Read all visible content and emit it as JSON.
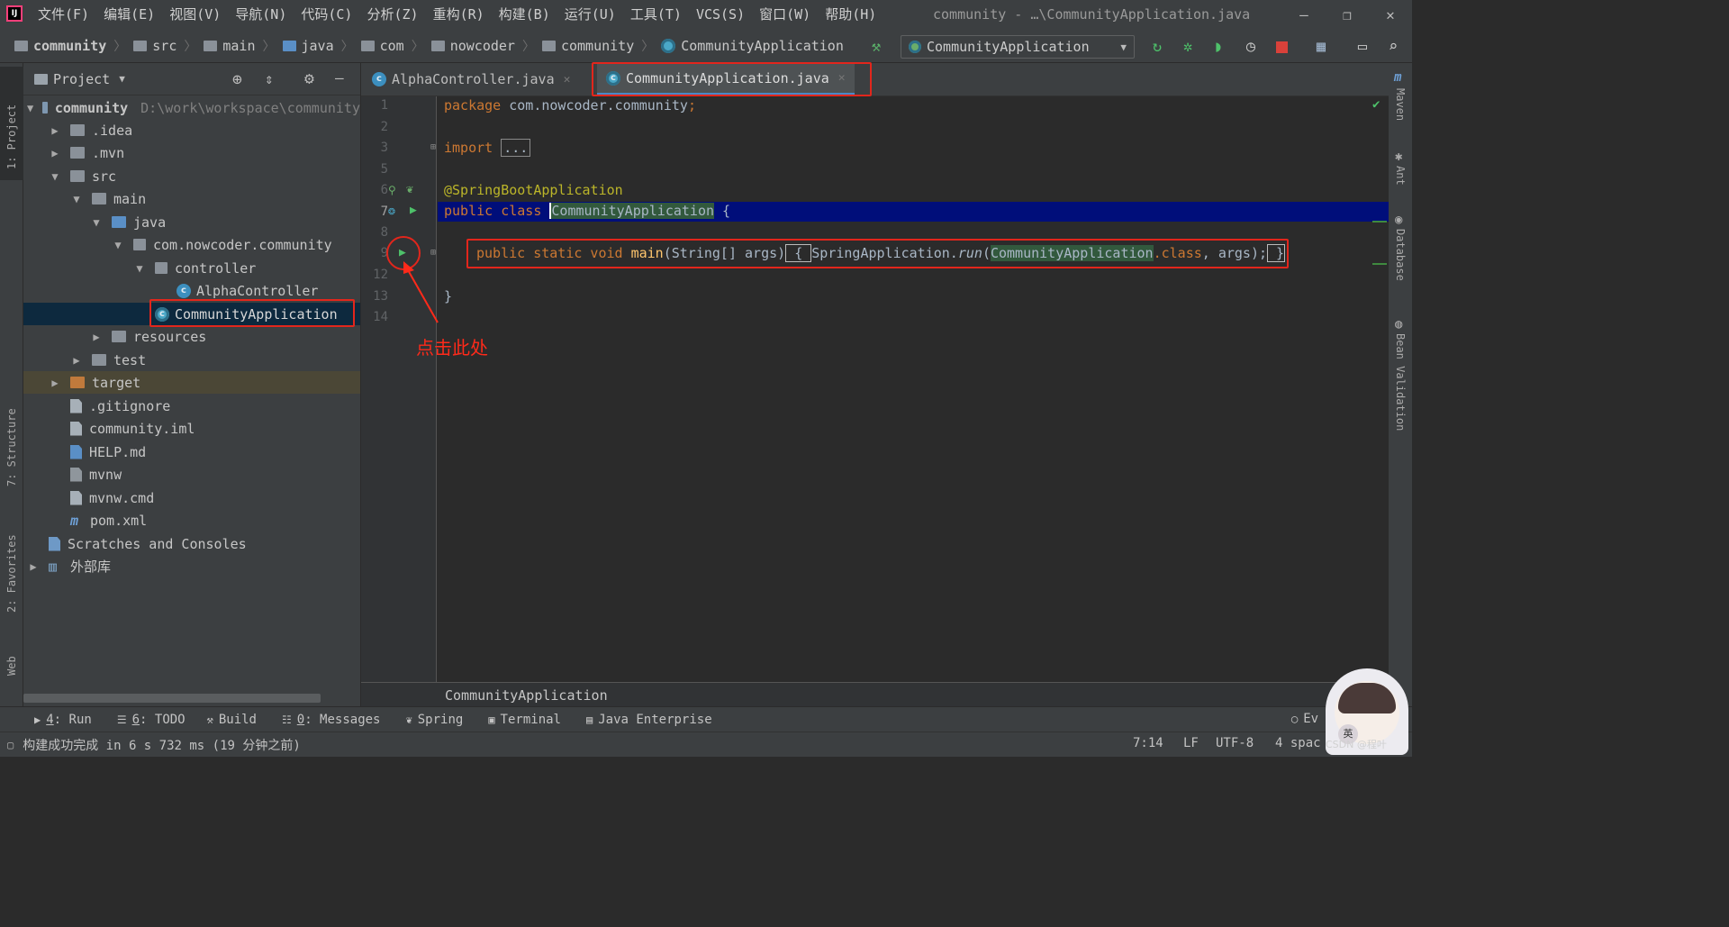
{
  "window": {
    "logo": "IJ",
    "title": "community - …\\CommunityApplication.java",
    "menus": [
      "文件(F)",
      "编辑(E)",
      "视图(V)",
      "导航(N)",
      "代码(C)",
      "分析(Z)",
      "重构(R)",
      "构建(B)",
      "运行(U)",
      "工具(T)",
      "VCS(S)",
      "窗口(W)",
      "帮助(H)"
    ],
    "controls": {
      "minimize": "—",
      "restore": "❐",
      "close": "✕"
    }
  },
  "navbar": {
    "breadcrumbs": [
      "community",
      "src",
      "main",
      "java",
      "com",
      "nowcoder",
      "community",
      "CommunityApplication"
    ],
    "run_config": "CommunityApplication"
  },
  "left_strip": {
    "items": [
      "1: Project",
      "7: Structure",
      "2: Favorites",
      "Web"
    ]
  },
  "project_panel": {
    "title": "Project",
    "tree": [
      {
        "label": "community",
        "hint": "D:\\work\\workspace\\community",
        "icon": "module-folder-icon"
      },
      {
        "label": ".idea",
        "icon": "folder-icon"
      },
      {
        "label": ".mvn",
        "icon": "folder-icon"
      },
      {
        "label": "src",
        "icon": "folder-icon"
      },
      {
        "label": "main",
        "icon": "folder-icon"
      },
      {
        "label": "java",
        "icon": "source-folder-icon"
      },
      {
        "label": "com.nowcoder.community",
        "icon": "package-icon"
      },
      {
        "label": "controller",
        "icon": "package-icon"
      },
      {
        "label": "AlphaController",
        "icon": "class-icon"
      },
      {
        "label": "CommunityApplication",
        "icon": "spring-class-icon"
      },
      {
        "label": "resources",
        "icon": "resources-folder-icon"
      },
      {
        "label": "test",
        "icon": "folder-icon"
      },
      {
        "label": "target",
        "icon": "excluded-folder-icon"
      },
      {
        "label": ".gitignore",
        "icon": "gitignore-file-icon"
      },
      {
        "label": "community.iml",
        "icon": "iml-file-icon"
      },
      {
        "label": "HELP.md",
        "icon": "markdown-file-icon"
      },
      {
        "label": "mvnw",
        "icon": "shell-file-icon"
      },
      {
        "label": "mvnw.cmd",
        "icon": "cmd-file-icon"
      },
      {
        "label": "pom.xml",
        "icon": "maven-file-icon"
      },
      {
        "label": "Scratches and Consoles",
        "icon": "scratches-icon"
      },
      {
        "label": "外部库",
        "icon": "library-icon"
      }
    ]
  },
  "editor": {
    "tabs": [
      {
        "label": "AlphaController.java",
        "active": false
      },
      {
        "label": "CommunityApplication.java",
        "active": true
      }
    ],
    "line_numbers": [
      "1",
      "2",
      "3",
      "5",
      "6",
      "7",
      "8",
      "9",
      "12",
      "13",
      "14"
    ],
    "code": {
      "l1_kw": "package",
      "l1_rest": " com.nowcoder.community",
      "l1_semi": ";",
      "l3_kw": "import",
      "l3_fold": "...",
      "l6": "@SpringBootApplication",
      "l7_kw": "public class ",
      "l7_name": "CommunityApplication",
      "l7_brace": " {",
      "l9_kw": "public static void ",
      "l9_fn": "main",
      "l9_params": "(String[] args)",
      "l9_open": " { ",
      "l9_call": "SpringApplication.",
      "l9_run": "run",
      "l9_paren": "(",
      "l9_cls": "CommunityApplication",
      "l9_dotclass": ".class",
      "l9_args": ", args);",
      "l9_close": " }",
      "l13": "}"
    },
    "breadcrumb": "CommunityApplication"
  },
  "annotation": {
    "text": "点击此处",
    "color": "#ff2a1a"
  },
  "right_strip": {
    "items": [
      "Maven",
      "Ant",
      "Database",
      "Bean Validation"
    ]
  },
  "bottom_tools": [
    {
      "key": "4",
      "label": ": Run",
      "icon": "run-icon"
    },
    {
      "key": "6",
      "label": ": TODO",
      "icon": "todo-icon"
    },
    {
      "key": "",
      "label": "Build",
      "icon": "hammer-icon"
    },
    {
      "key": "0",
      "label": ": Messages",
      "icon": "messages-icon"
    },
    {
      "key": "",
      "label": "Spring",
      "icon": "spring-icon"
    },
    {
      "key": "",
      "label": "Terminal",
      "icon": "terminal-icon"
    },
    {
      "key": "",
      "label": "Java Enterprise",
      "icon": "java-enterprise-icon"
    }
  ],
  "event_log": "Ev",
  "status": {
    "message": "构建成功完成 in 6 s 732 ms (19 分钟之前)",
    "position": "7:14",
    "line_sep": "LF",
    "encoding": "UTF-8",
    "indent": "4 spac",
    "watermark": "CSDN @程叶",
    "ime": "英"
  },
  "colors": {
    "accent": "#4a88c7",
    "highlight_box": "#e2261c",
    "current_line": "#000e7a"
  }
}
